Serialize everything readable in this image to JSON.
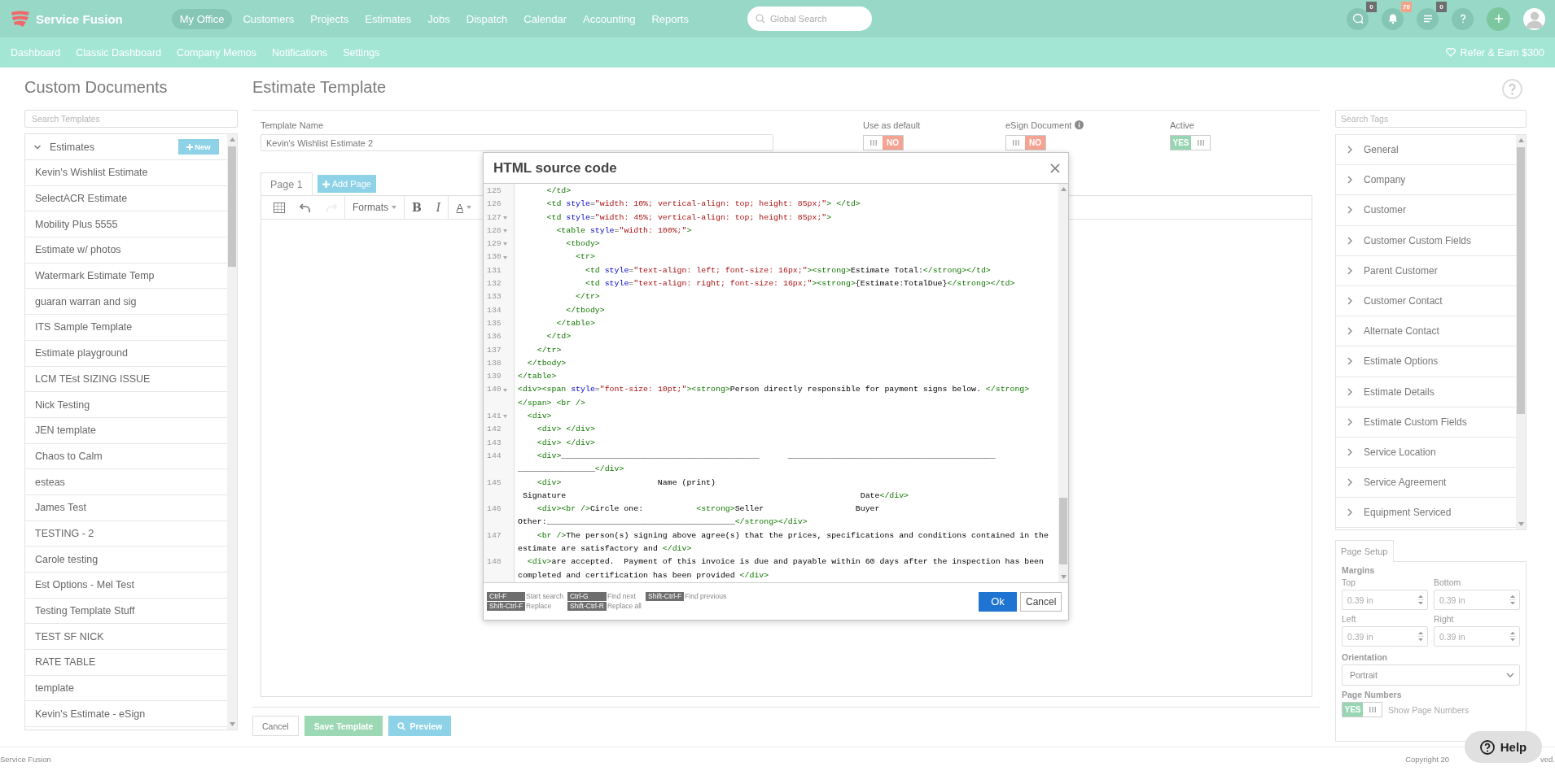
{
  "app_bar": {
    "brand": "Service Fusion",
    "nav": [
      {
        "label": "My Office",
        "selected": true
      },
      {
        "label": "Customers",
        "selected": false
      },
      {
        "label": "Projects",
        "selected": false
      },
      {
        "label": "Estimates",
        "selected": false
      },
      {
        "label": "Jobs",
        "selected": false
      },
      {
        "label": "Dispatch",
        "selected": false
      },
      {
        "label": "Calendar",
        "selected": false
      },
      {
        "label": "Accounting",
        "selected": false
      },
      {
        "label": "Reports",
        "selected": false
      }
    ],
    "search": {
      "placeholder": "Global Search"
    },
    "actions": [
      {
        "kind": "chat",
        "badge": "0"
      },
      {
        "kind": "bell",
        "badge": "70"
      },
      {
        "kind": "list",
        "badge": "0"
      },
      {
        "kind": "help"
      },
      {
        "kind": "add"
      },
      {
        "kind": "avatar"
      }
    ]
  },
  "sub_nav": {
    "items": [
      "Dashboard",
      "Classic Dashboard",
      "Company Memos",
      "Notifications",
      "Settings"
    ],
    "refer": "Refer & Earn $300"
  },
  "sidebar": {
    "title": "Custom Documents",
    "search": {
      "placeholder": "Search Templates"
    },
    "group": {
      "label": "Estimates",
      "expanded": true,
      "new_button": "New"
    },
    "items": [
      "Kevin's Wishlist Estimate",
      "SelectACR Estimate",
      "Mobility Plus 5555",
      "Estimate w/ photos",
      "Watermark Estimate Temp",
      "guaran warran and sig",
      "ITS Sample Template",
      "Estimate playground",
      "LCM TEst SIZING ISSUE",
      "Nick Testing",
      "JEN template",
      "Chaos to Calm",
      "esteas",
      "James Test",
      "TESTING - 2",
      "Carole testing",
      "Est Options - Mel Test",
      "Testing Template Stuff",
      "TEST SF NICK",
      "RATE TABLE",
      "template",
      "Kevin's Estimate - eSign"
    ]
  },
  "editor": {
    "title": "Estimate Template",
    "template_name": {
      "label": "Template Name",
      "value": "Kevin's Wishlist Estimate 2"
    },
    "toggles": [
      {
        "label": "Use as default",
        "on": false,
        "text": "NO",
        "info": false
      },
      {
        "label": "eSign Document",
        "on": false,
        "text": "NO",
        "info": true
      },
      {
        "label": "Active",
        "on": true,
        "text": "YES",
        "info": false
      }
    ],
    "page_tabs": [
      {
        "label": "Page 1",
        "selected": true
      }
    ],
    "add_page": "Add Page",
    "toolbar": [
      {
        "kind": "table",
        "disabled": false
      },
      {
        "kind": "undo",
        "disabled": false
      },
      {
        "kind": "redo",
        "disabled": true
      },
      {
        "kind": "dropdown",
        "label": "Formats",
        "disabled": false
      },
      {
        "kind": "bold",
        "label": "B",
        "disabled": false
      },
      {
        "kind": "italic",
        "label": "I",
        "disabled": false
      },
      {
        "kind": "color",
        "label": "A",
        "disabled": false
      }
    ],
    "buttons": [
      {
        "label": "Cancel",
        "kind": "plain"
      },
      {
        "label": "Save Template",
        "kind": "save"
      },
      {
        "label": "Preview",
        "kind": "preview"
      }
    ]
  },
  "tags": {
    "search": {
      "placeholder": "Search Tags"
    },
    "items": [
      "General",
      "Company",
      "Customer",
      "Customer Custom Fields",
      "Parent Customer",
      "Customer Contact",
      "Alternate Contact",
      "Estimate Options",
      "Estimate Details",
      "Estimate Custom Fields",
      "Service Location",
      "Service Agreement",
      "Equipment Serviced"
    ]
  },
  "page_setup": {
    "tab": "Page Setup",
    "margins_heading": "Margins",
    "margins": [
      {
        "label": "Top",
        "value": "0.39 in"
      },
      {
        "label": "Bottom",
        "value": "0.39 in"
      },
      {
        "label": "Left",
        "value": "0.39 in"
      },
      {
        "label": "Right",
        "value": "0.39 in"
      }
    ],
    "orientation": {
      "label": "Orientation",
      "value": "Portrait"
    },
    "page_numbers": {
      "label": "Page Numbers",
      "on": true,
      "text": "YES",
      "caption": "Show Page Numbers"
    }
  },
  "modal": {
    "title": "HTML source code",
    "lines": [
      {
        "num": "125",
        "fold": false,
        "tokens": [
          {
            "kind": "tag",
            "text": "      </td>"
          }
        ]
      },
      {
        "num": "126",
        "fold": false,
        "tokens": [
          {
            "kind": "tag",
            "text": "      <td "
          },
          {
            "kind": "attr",
            "text": "style"
          },
          {
            "kind": "punct",
            "text": "="
          },
          {
            "kind": "string",
            "text": "\"width: 10%; vertical-align: top; height: 85px;\""
          },
          {
            "kind": "tag",
            "text": "> </td>"
          }
        ]
      },
      {
        "num": "127",
        "fold": true,
        "tokens": [
          {
            "kind": "tag",
            "text": "      <td "
          },
          {
            "kind": "attr",
            "text": "style"
          },
          {
            "kind": "punct",
            "text": "="
          },
          {
            "kind": "string",
            "text": "\"width: 45%; vertical-align: top; height: 85px;\""
          },
          {
            "kind": "tag",
            "text": ">"
          }
        ]
      },
      {
        "num": "128",
        "fold": true,
        "tokens": [
          {
            "kind": "tag",
            "text": "        <table "
          },
          {
            "kind": "attr",
            "text": "style"
          },
          {
            "kind": "punct",
            "text": "="
          },
          {
            "kind": "string",
            "text": "\"width: 100%;\""
          },
          {
            "kind": "tag",
            "text": ">"
          }
        ]
      },
      {
        "num": "129",
        "fold": true,
        "tokens": [
          {
            "kind": "tag",
            "text": "          <tbody>"
          }
        ]
      },
      {
        "num": "130",
        "fold": true,
        "tokens": [
          {
            "kind": "tag",
            "text": "            <tr>"
          }
        ]
      },
      {
        "num": "131",
        "fold": false,
        "tokens": [
          {
            "kind": "tag",
            "text": "              <td "
          },
          {
            "kind": "attr",
            "text": "style"
          },
          {
            "kind": "punct",
            "text": "="
          },
          {
            "kind": "string",
            "text": "\"text-align: left; font-size: 16px;\""
          },
          {
            "kind": "tag",
            "text": "><strong>"
          },
          {
            "kind": "text",
            "text": "Estimate Total:"
          },
          {
            "kind": "tag",
            "text": "</strong></td>"
          }
        ]
      },
      {
        "num": "132",
        "fold": false,
        "tokens": [
          {
            "kind": "tag",
            "text": "              <td "
          },
          {
            "kind": "attr",
            "text": "style"
          },
          {
            "kind": "punct",
            "text": "="
          },
          {
            "kind": "string",
            "text": "\"text-align: right; font-size: 16px;\""
          },
          {
            "kind": "tag",
            "text": "><strong>"
          },
          {
            "kind": "text",
            "text": "{Estimate:TotalDue}"
          },
          {
            "kind": "tag",
            "text": "</strong></td>"
          }
        ]
      },
      {
        "num": "133",
        "fold": false,
        "tokens": [
          {
            "kind": "tag",
            "text": "            </tr>"
          }
        ]
      },
      {
        "num": "134",
        "fold": false,
        "tokens": [
          {
            "kind": "tag",
            "text": "          </tbody>"
          }
        ]
      },
      {
        "num": "135",
        "fold": false,
        "tokens": [
          {
            "kind": "tag",
            "text": "        </table>"
          }
        ]
      },
      {
        "num": "136",
        "fold": false,
        "tokens": [
          {
            "kind": "tag",
            "text": "      </td>"
          }
        ]
      },
      {
        "num": "137",
        "fold": false,
        "tokens": [
          {
            "kind": "tag",
            "text": "    </tr>"
          }
        ]
      },
      {
        "num": "138",
        "fold": false,
        "tokens": [
          {
            "kind": "tag",
            "text": "  </tbody>"
          }
        ]
      },
      {
        "num": "139",
        "fold": false,
        "tokens": [
          {
            "kind": "tag",
            "text": "</table>"
          }
        ]
      },
      {
        "num": "140",
        "fold": true,
        "tokens": [
          {
            "kind": "tag",
            "text": "<div><span "
          },
          {
            "kind": "attr",
            "text": "style"
          },
          {
            "kind": "punct",
            "text": "="
          },
          {
            "kind": "string",
            "text": "\"font-size: 10pt;\""
          },
          {
            "kind": "tag",
            "text": "><strong>"
          },
          {
            "kind": "text",
            "text": "Person directly responsible for payment signs below. "
          },
          {
            "kind": "tag",
            "text": "</strong>"
          }
        ]
      },
      {
        "tokens": [
          {
            "kind": "tag",
            "text": "</span> <br />"
          }
        ]
      },
      {
        "num": "141",
        "fold": true,
        "tokens": [
          {
            "kind": "tag",
            "text": "  <div>"
          }
        ]
      },
      {
        "num": "142",
        "fold": false,
        "tokens": [
          {
            "kind": "tag",
            "text": "    <div> </div>"
          }
        ]
      },
      {
        "num": "143",
        "fold": false,
        "tokens": [
          {
            "kind": "tag",
            "text": "    <div> </div>"
          }
        ]
      },
      {
        "num": "144",
        "fold": false,
        "tokens": [
          {
            "kind": "tag",
            "text": "    <div>"
          },
          {
            "kind": "text",
            "text": "_________________________________________      ___________________________________________"
          }
        ]
      },
      {
        "tokens": [
          {
            "kind": "text",
            "text": "________________"
          },
          {
            "kind": "tag",
            "text": "</div>"
          }
        ]
      },
      {
        "num": "145",
        "fold": false,
        "tokens": [
          {
            "kind": "tag",
            "text": "    <div>"
          },
          {
            "kind": "text",
            "text": "                    Name (print)"
          }
        ]
      },
      {
        "tokens": [
          {
            "kind": "text",
            "text": " Signature                                                             Date"
          },
          {
            "kind": "tag",
            "text": "</div>"
          }
        ]
      },
      {
        "num": "146",
        "fold": false,
        "tokens": [
          {
            "kind": "tag",
            "text": "    <div><br />"
          },
          {
            "kind": "text",
            "text": "Circle one:           "
          },
          {
            "kind": "tag",
            "text": "<strong>"
          },
          {
            "kind": "text",
            "text": "Seller                   Buyer"
          }
        ]
      },
      {
        "tokens": [
          {
            "kind": "text",
            "text": "Other:_______________________________________"
          },
          {
            "kind": "tag",
            "text": "</strong></div>"
          }
        ]
      },
      {
        "num": "147",
        "fold": false,
        "tokens": [
          {
            "kind": "tag",
            "text": "    <br />"
          },
          {
            "kind": "text",
            "text": "The person(s) signing above agree(s) that the prices, specifications and conditions contained in the"
          }
        ]
      },
      {
        "tokens": [
          {
            "kind": "text",
            "text": "estimate are satisfactory and "
          },
          {
            "kind": "tag",
            "text": "</div>"
          }
        ]
      },
      {
        "num": "148",
        "fold": false,
        "tokens": [
          {
            "kind": "tag",
            "text": "  <div>"
          },
          {
            "kind": "text",
            "text": "are accepted.  Payment of this invoice is due and payable within 60 days after the inspection has been"
          }
        ]
      },
      {
        "tokens": [
          {
            "kind": "text",
            "text": "completed and certification has been provided "
          },
          {
            "kind": "tag",
            "text": "</div>"
          }
        ]
      }
    ],
    "shortcuts": [
      {
        "key": "Ctrl-F",
        "action": "Start search"
      },
      {
        "key": "Ctrl-G",
        "action": "Find next"
      },
      {
        "key": "Shift-Ctrl-F",
        "action": "Find previous"
      },
      {
        "key": "Shift-Ctrl-F",
        "action": "Replace"
      },
      {
        "key": "Shift-Ctrl-R",
        "action": "Replace all"
      }
    ],
    "buttons": [
      {
        "label": "Ok",
        "kind": "primary"
      },
      {
        "label": "Cancel",
        "kind": "plain"
      }
    ]
  },
  "footer": {
    "brand": "Service Fusion",
    "copyright_start": "Copyright 20",
    "copyright_end": "ved."
  },
  "help_button": {
    "label": "Help"
  }
}
